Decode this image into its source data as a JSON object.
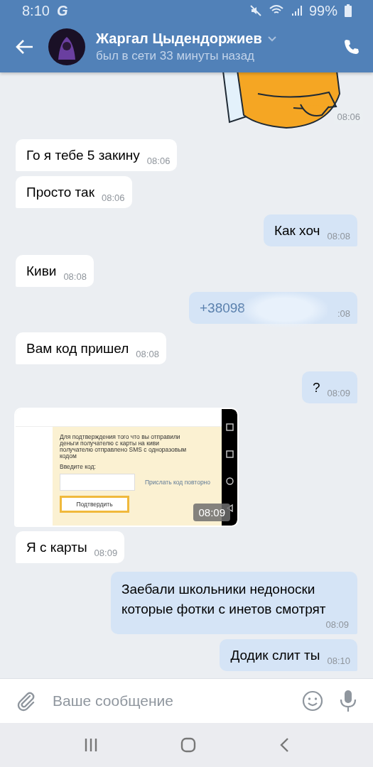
{
  "status_bar": {
    "time": "8:10",
    "carrier_glyph": "G",
    "battery": "99%"
  },
  "header": {
    "name": "Жаргал Цыдендоржиев",
    "status": "был в сети 33 минуты назад"
  },
  "messages": [
    {
      "kind": "sticker",
      "outgoing": true,
      "time": "08:06"
    },
    {
      "kind": "text",
      "outgoing": false,
      "text": "Го я тебе 5 закину",
      "time": "08:06"
    },
    {
      "kind": "text",
      "outgoing": false,
      "text": "Просто так",
      "time": "08:06"
    },
    {
      "kind": "text",
      "outgoing": true,
      "text": "Как хоч",
      "time": "08:08"
    },
    {
      "kind": "text",
      "outgoing": false,
      "text": "Киви",
      "time": "08:08"
    },
    {
      "kind": "redacted",
      "outgoing": true,
      "text": "+38098",
      "time": ":08"
    },
    {
      "kind": "text",
      "outgoing": false,
      "text": "Вам код пришел",
      "time": "08:08"
    },
    {
      "kind": "text",
      "outgoing": true,
      "text": "?",
      "time": "08:09"
    },
    {
      "kind": "screenshot",
      "outgoing": false,
      "time": "08:09",
      "info": "Для подтверждения того что вы отправили деньги получателю с карты на киви получателю отправлено SMS с одноразовым кодом",
      "code_label": "Введите код:",
      "resend": "Прислать код повторно",
      "confirm": "Подтвердить"
    },
    {
      "kind": "text",
      "outgoing": false,
      "text": "Я с карты",
      "time": "08:09"
    },
    {
      "kind": "multiline",
      "outgoing": true,
      "text": "Заебали школьники недоноски которые фотки с инетов смотрят",
      "time": "08:09"
    },
    {
      "kind": "text",
      "outgoing": true,
      "text": "Додик слит ты",
      "time": "08:10"
    }
  ],
  "composer": {
    "placeholder": "Ваше сообщение"
  }
}
